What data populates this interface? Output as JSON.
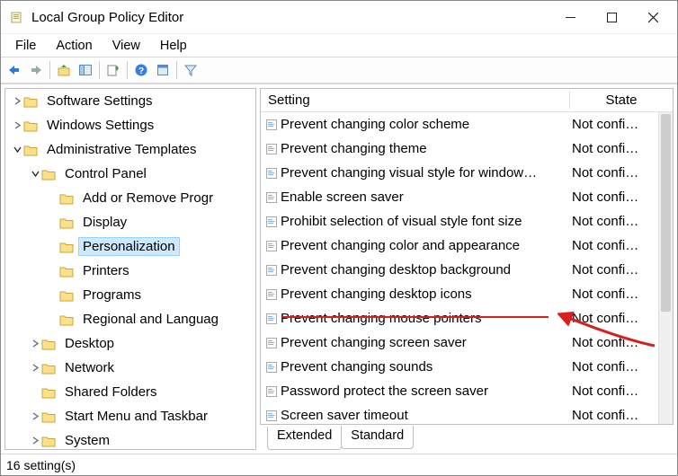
{
  "window": {
    "title": "Local Group Policy Editor"
  },
  "menubar": {
    "file": "File",
    "action": "Action",
    "view": "View",
    "help": "Help"
  },
  "tree": {
    "items": [
      {
        "label": "Software Settings",
        "expand": "right",
        "indent": 1
      },
      {
        "label": "Windows Settings",
        "expand": "right",
        "indent": 1
      },
      {
        "label": "Administrative Templates",
        "expand": "down",
        "indent": 1
      },
      {
        "label": "Control Panel",
        "expand": "down",
        "indent": 2
      },
      {
        "label": "Add or Remove Progr",
        "expand": "",
        "indent": 3
      },
      {
        "label": "Display",
        "expand": "",
        "indent": 3
      },
      {
        "label": "Personalization",
        "expand": "",
        "indent": 3,
        "selected": true
      },
      {
        "label": "Printers",
        "expand": "",
        "indent": 3
      },
      {
        "label": "Programs",
        "expand": "",
        "indent": 3
      },
      {
        "label": "Regional and Languag",
        "expand": "",
        "indent": 3
      },
      {
        "label": "Desktop",
        "expand": "right",
        "indent": 2
      },
      {
        "label": "Network",
        "expand": "right",
        "indent": 2
      },
      {
        "label": "Shared Folders",
        "expand": "",
        "indent": 2
      },
      {
        "label": "Start Menu and Taskbar",
        "expand": "right",
        "indent": 2
      },
      {
        "label": "System",
        "expand": "right",
        "indent": 2
      }
    ]
  },
  "columns": {
    "setting": "Setting",
    "state": "State"
  },
  "settings": [
    {
      "name": "Prevent changing color scheme",
      "state": "Not confi…"
    },
    {
      "name": "Prevent changing theme",
      "state": "Not confi…"
    },
    {
      "name": "Prevent changing visual style for window…",
      "state": "Not confi…"
    },
    {
      "name": "Enable screen saver",
      "state": "Not confi…"
    },
    {
      "name": "Prohibit selection of visual style font size",
      "state": "Not confi…"
    },
    {
      "name": "Prevent changing color and appearance",
      "state": "Not confi…"
    },
    {
      "name": "Prevent changing desktop background",
      "state": "Not confi…"
    },
    {
      "name": "Prevent changing desktop icons",
      "state": "Not confi…"
    },
    {
      "name": "Prevent changing mouse pointers",
      "state": "Not confi…"
    },
    {
      "name": "Prevent changing screen saver",
      "state": "Not confi…"
    },
    {
      "name": "Prevent changing sounds",
      "state": "Not confi…"
    },
    {
      "name": "Password protect the screen saver",
      "state": "Not confi…"
    },
    {
      "name": "Screen saver timeout",
      "state": "Not confi…"
    }
  ],
  "tabs": {
    "extended": "Extended",
    "standard": "Standard"
  },
  "status": "16 setting(s)"
}
